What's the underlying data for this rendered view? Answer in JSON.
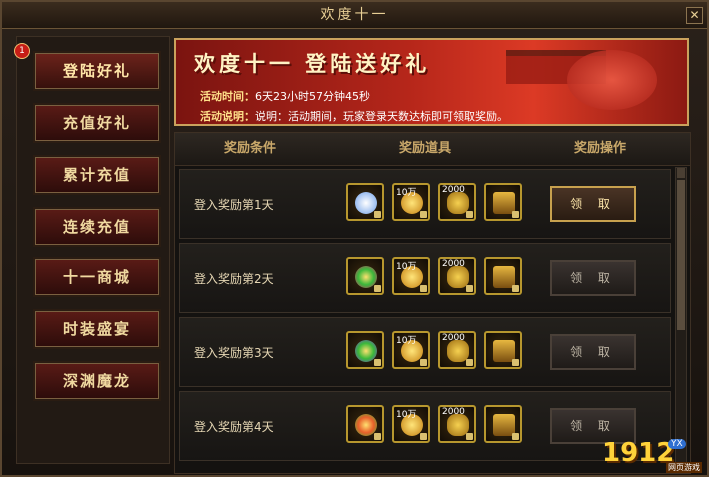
{
  "window": {
    "title": "欢度十一"
  },
  "sidebar": {
    "badge": "1",
    "items": [
      {
        "label": "登陆好礼",
        "active": true
      },
      {
        "label": "充值好礼"
      },
      {
        "label": "累计充值"
      },
      {
        "label": "连续充值"
      },
      {
        "label": "十一商城"
      },
      {
        "label": "时装盛宴"
      },
      {
        "label": "深渊魔龙"
      }
    ]
  },
  "banner": {
    "title": "欢度十一 登陆送好礼",
    "time_label": "活动时间：",
    "time_value": "6天23小时57分钟45秒",
    "desc_label": "活动说明：",
    "desc_value": "说明：活动期间，玩家登录天数达标即可领取奖励。"
  },
  "table": {
    "headers": [
      "奖励条件",
      "奖励道具",
      "奖励操作"
    ],
    "rows": [
      {
        "condition": "登入奖励第1天",
        "counts": [
          "",
          "10万",
          "2000",
          ""
        ],
        "button": "领 取",
        "claimable": true
      },
      {
        "condition": "登入奖励第2天",
        "counts": [
          "",
          "10万",
          "2000",
          ""
        ],
        "button": "领 取",
        "claimable": false
      },
      {
        "condition": "登入奖励第3天",
        "counts": [
          "",
          "10万",
          "2000",
          ""
        ],
        "button": "领 取",
        "claimable": false
      },
      {
        "condition": "登入奖励第4天",
        "counts": [
          "",
          "10万",
          "2000",
          ""
        ],
        "button": "领 取",
        "claimable": false
      }
    ]
  },
  "logo": {
    "number": "1912",
    "tag": "YX",
    "sub": "网页游戏"
  },
  "colors": {
    "accent_gold": "#c9a86a",
    "button_active": "#c7a14e",
    "banner_red": "#b5261a"
  },
  "icons": [
    "close-icon",
    "crystal-icon",
    "gold-coin-icon",
    "gold-ingot-icon",
    "treasure-chest-icon",
    "lock-icon"
  ]
}
